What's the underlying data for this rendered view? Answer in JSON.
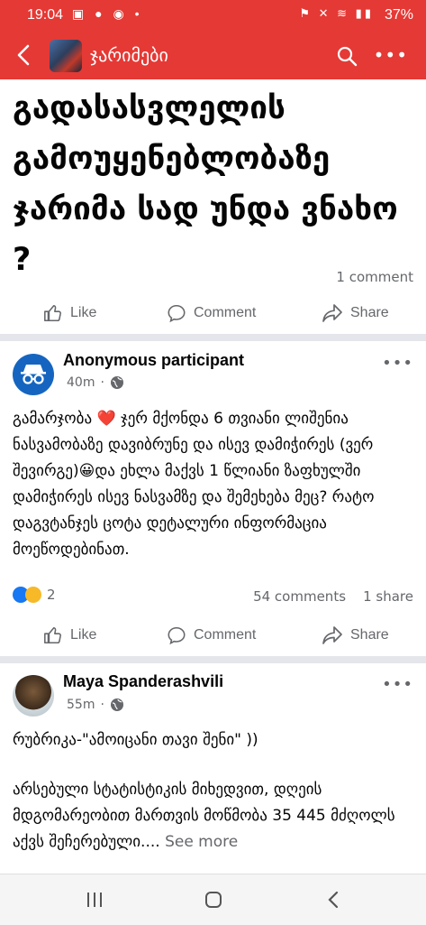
{
  "status_bar": {
    "time": "19:04",
    "battery": "37%"
  },
  "app_bar": {
    "title": "ჯარიმები"
  },
  "post": {
    "title": "გადასასვლელის გამოუყენებლობაზე ჯარიმა სად უნდა ვნახო ?",
    "comment_count": "1 comment"
  },
  "actions": {
    "like": "Like",
    "comment": "Comment",
    "share": "Share"
  },
  "comments": [
    {
      "author": "Anonymous participant",
      "time": "40m",
      "text": "გამარჯობა ❤️ ჯერ მქონდა 6 თვიანი ლიშენია ნასვამობაზე დავიბრუნე და ისევ დამიჭირეს (ვერ შევირგე)😀და ეხლა მაქვს 1 წლიანი ზაფხულში დამიჭირეს ისევ ნასვამზე და შემეხება მეც? რატო დაგვტანჯეს ცოტა დეტალური ინფორმაცია მოეწოდებინათ.",
      "reaction_count": "2",
      "comments": "54 comments",
      "shares": "1 share"
    },
    {
      "author": "Maya Spanderashvili",
      "time": "55m",
      "text_line1": "რუბრიკა-\"ამოიცანი თავი შენი\" ))",
      "text_body": "არსებული სტატისტიკის მიხედვით, დღეის მდგომარეობით მართვის მოწმობა 35 445 მძღოლს აქვს შეჩერებული....",
      "see_more": "See more"
    }
  ],
  "icons": {
    "back": "arrow-left",
    "search": "magnifier",
    "more": "three-dots",
    "like": "thumbs-up",
    "comment": "speech-bubble",
    "share": "share-arrow",
    "globe": "globe"
  },
  "colors": {
    "brand": "#e53935",
    "facebook_blue": "#1877f2",
    "muted": "#65676b"
  }
}
